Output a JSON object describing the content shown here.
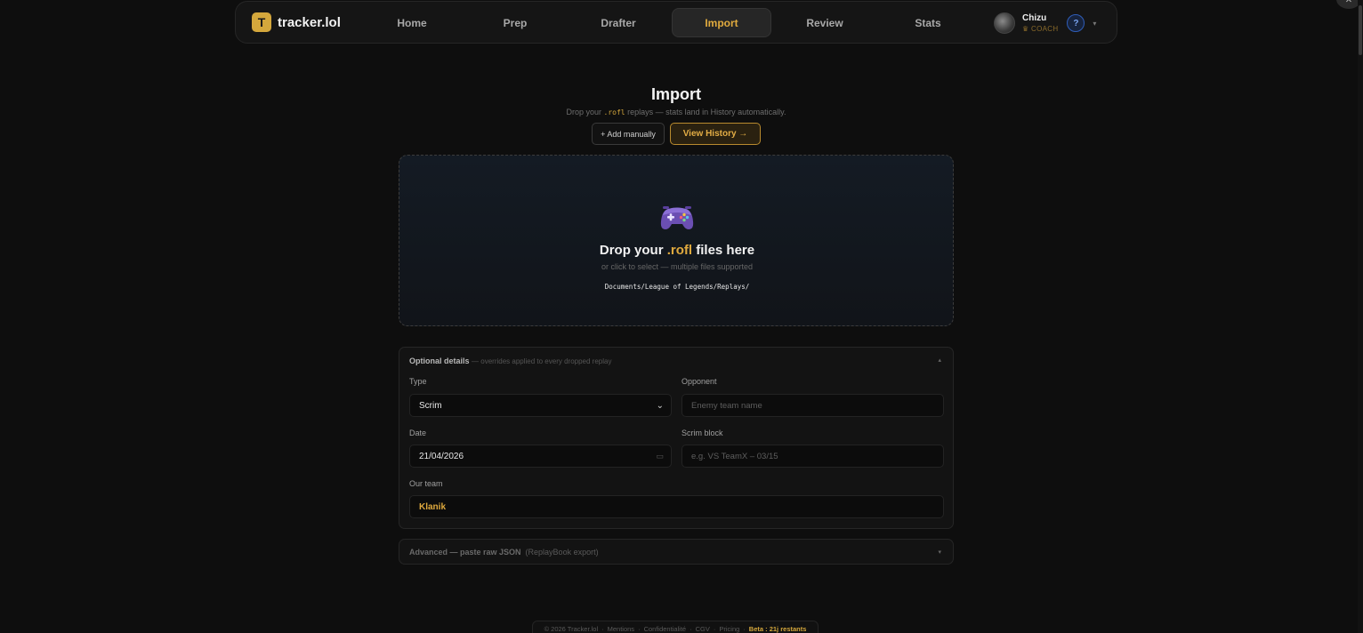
{
  "nav": {
    "brand": {
      "logo_letter": "T",
      "name": "tracker.lol"
    },
    "items": [
      {
        "label": "Home",
        "active": false
      },
      {
        "label": "Prep",
        "active": false
      },
      {
        "label": "Drafter",
        "active": false
      },
      {
        "label": "Import",
        "active": true
      },
      {
        "label": "Review",
        "active": false
      },
      {
        "label": "Stats",
        "active": false
      }
    ],
    "user": {
      "name": "Chizu",
      "role": "COACH",
      "role_icon": "crown-icon",
      "help": "?"
    }
  },
  "header": {
    "title": "Import",
    "subtitle_prefix": "Drop your",
    "subtitle_code": ".rofl",
    "subtitle_suffix": "replays — stats land in History automatically.",
    "add_manually": "+ Add manually",
    "view_history": "View History →"
  },
  "dropzone": {
    "icon": "gamepad-icon",
    "title_prefix": "Drop your",
    "title_accent": ".rofl",
    "title_suffix": "files here",
    "hint": "or click to select — multiple files supported",
    "path": "Documents/League of Legends/Replays/"
  },
  "details": {
    "title": "Optional details",
    "subtitle": "— overrides applied to every dropped replay",
    "type": {
      "label": "Type",
      "value": "Scrim"
    },
    "opponent": {
      "label": "Opponent",
      "placeholder": "Enemy team name"
    },
    "date": {
      "label": "Date",
      "value": "21/04/2026"
    },
    "scrim_block": {
      "label": "Scrim block",
      "placeholder": "e.g. VS TeamX – 03/15"
    },
    "our_team": {
      "label": "Our team",
      "value": "Klanik"
    }
  },
  "advanced": {
    "title": "Advanced — paste raw JSON",
    "subtitle": "(ReplayBook export)"
  },
  "footer": {
    "copyright": "© 2026 Tracker.lol",
    "links": [
      "Mentions",
      "Confidentialité",
      "CGV",
      "Pricing"
    ],
    "beta": "Beta : 21j restants"
  },
  "colors": {
    "accent": "#e0aa3e",
    "background": "#0e0e0e",
    "panel": "#131313"
  }
}
